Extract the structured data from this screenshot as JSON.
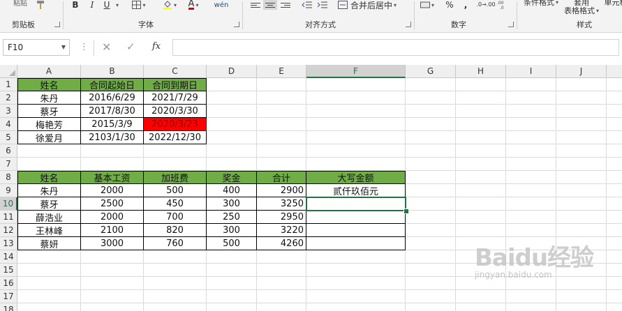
{
  "ribbon": {
    "groups": [
      {
        "label": "剪贴板"
      },
      {
        "label": "字体"
      },
      {
        "label": "对齐方式"
      },
      {
        "label": "数字"
      },
      {
        "label": "样式"
      }
    ],
    "paste_label": "粘贴",
    "bold": "B",
    "italic": "I",
    "underline": "U",
    "font_color_glyph": "A",
    "wen_glyph": "wén",
    "merge_center_label": "合并后居中",
    "percent": "%",
    "comma": ",",
    "decimal_inc": ".0→.00",
    "cond_format_label": "条件格式",
    "table_format_label_1": "套用",
    "table_format_label_2": "表格格式",
    "cell_style_label": "单元格"
  },
  "formula_bar": {
    "name_box": "F10",
    "fx": "fx",
    "formula": ""
  },
  "columns": [
    "A",
    "B",
    "C",
    "D",
    "E",
    "F",
    "G",
    "H",
    "I",
    "J"
  ],
  "rows": [
    "1",
    "2",
    "3",
    "4",
    "5",
    "6",
    "7",
    "8",
    "9",
    "10",
    "11",
    "12",
    "13",
    "14",
    "15",
    "16",
    "17",
    "18"
  ],
  "selected_cell": "F10",
  "colors": {
    "header_fill": "#70ad47",
    "highlight_fill": "#ff0000",
    "selection": "#217346"
  },
  "table1": {
    "headers": [
      "姓名",
      "合同起始日",
      "合同到期日"
    ],
    "rows": [
      [
        "朱丹",
        "2016/6/29",
        "2021/7/29"
      ],
      [
        "蔡牙",
        "2017/8/30",
        "2020/3/30"
      ],
      [
        "梅艳芳",
        "2015/3/9",
        "2020/3/23"
      ],
      [
        "徐爱月",
        "2103/1/30",
        "2022/12/30"
      ]
    ]
  },
  "table2": {
    "headers": [
      "姓名",
      "基本工资",
      "加班费",
      "奖金",
      "合计",
      "大写金额"
    ],
    "rows": [
      [
        "朱丹",
        "2000",
        "500",
        "400",
        "2900",
        "贰仟玖佰元"
      ],
      [
        "蔡牙",
        "2500",
        "450",
        "300",
        "3250",
        ""
      ],
      [
        "薛浩业",
        "2000",
        "700",
        "250",
        "2950",
        ""
      ],
      [
        "王林峰",
        "2100",
        "820",
        "300",
        "3220",
        ""
      ],
      [
        "蔡妍",
        "3000",
        "760",
        "500",
        "4260",
        ""
      ]
    ]
  },
  "watermark": {
    "logo": "Baidu经验",
    "sub": "jingyan.baidu.com"
  }
}
